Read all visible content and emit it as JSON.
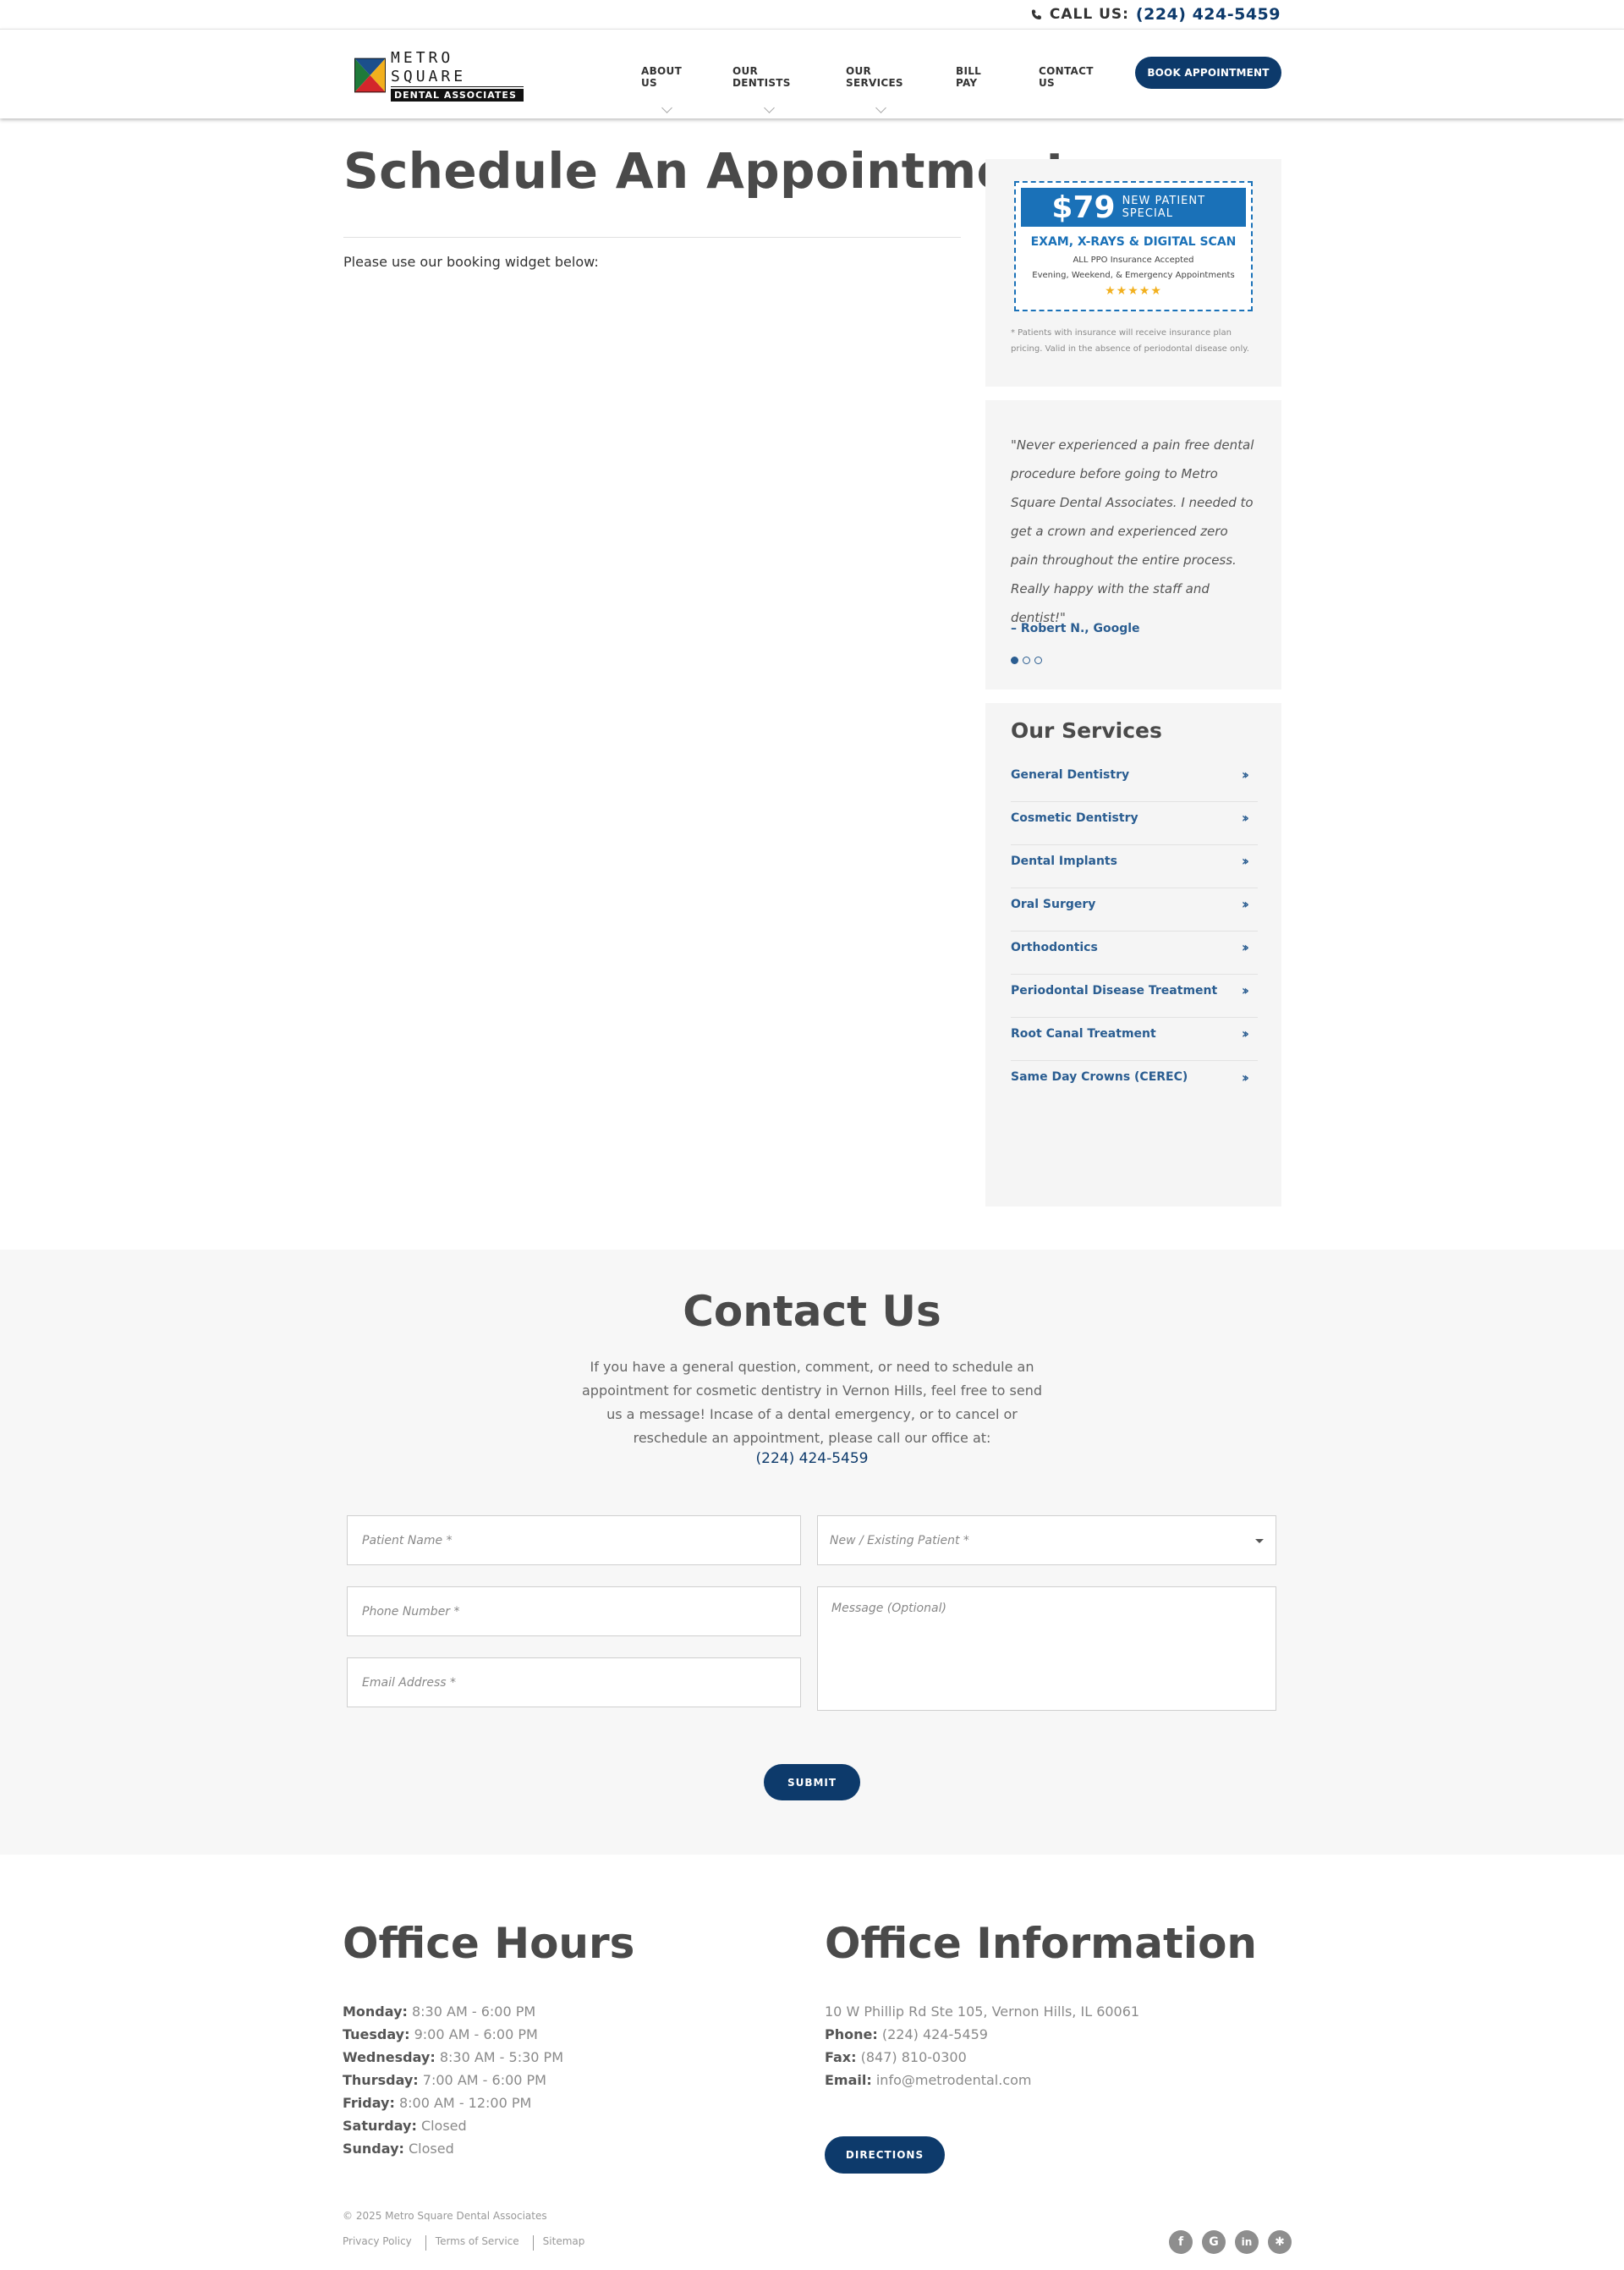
{
  "topbar": {
    "call_label": "CALL US:",
    "phone": "(224) 424-5459"
  },
  "logo": {
    "line1": "METRO SQUARE",
    "line2": "DENTAL ASSOCIATES"
  },
  "nav": {
    "items": [
      {
        "label": "About Us"
      },
      {
        "label": "Our Dentists"
      },
      {
        "label": "Our Services"
      },
      {
        "label": "Bill Pay"
      },
      {
        "label": "Contact Us"
      }
    ],
    "book_label": "Book Appointment"
  },
  "main": {
    "title": "Schedule An Appointment",
    "intro": "Please use our booking widget below:"
  },
  "promo": {
    "price": "$79",
    "special": "NEW PATIENT SPECIAL",
    "line1": "EXAM, X-RAYS & DIGITAL SCAN",
    "line2": "ALL PPO Insurance Accepted",
    "line3": "Evening, Weekend, & Emergency Appointments",
    "stars": "★★★★★",
    "rating": 5,
    "note": "* Patients with insurance will receive insurance plan pricing. Valid in the absence of periodontal disease only."
  },
  "review": {
    "quote": "\"Never experienced a pain free dental procedure before going to Metro Square Dental Associates. I needed to get a crown and experienced zero pain throughout the entire process. Really happy with the staff and dentist!\"",
    "author": "– Robert N., Google",
    "slides": 3,
    "active_slide": 1
  },
  "services": {
    "title": "Our Services",
    "items": [
      {
        "label": "General Dentistry"
      },
      {
        "label": "Cosmetic Dentistry"
      },
      {
        "label": "Dental Implants"
      },
      {
        "label": "Oral Surgery"
      },
      {
        "label": "Orthodontics"
      },
      {
        "label": "Periodontal Disease Treatment"
      },
      {
        "label": "Root Canal Treatment"
      },
      {
        "label": "Same Day Crowns (CEREC)"
      }
    ]
  },
  "contact": {
    "title": "Contact Us",
    "text": "If you have a general question, comment, or need to schedule an appointment for cosmetic dentistry in Vernon Hills, feel free to send us a message! Incase of a dental emergency, or to cancel or reschedule an appointment, please call our office at:",
    "phone": "(224) 424-5459",
    "form": {
      "name_placeholder": "Patient Name *",
      "phone_placeholder": "Phone Number *",
      "email_placeholder": "Email Address *",
      "patient_type_placeholder": "New / Existing Patient *",
      "message_placeholder": "Message (Optional)",
      "submit_label": "Submit"
    }
  },
  "footer": {
    "hours_title": "Office Hours",
    "hours": [
      {
        "day": "Monday:",
        "time": "8:30 AM - 6:00 PM"
      },
      {
        "day": "Tuesday:",
        "time": "9:00 AM - 6:00 PM"
      },
      {
        "day": "Wednesday:",
        "time": "8:30 AM - 5:30 PM"
      },
      {
        "day": "Thursday:",
        "time": "7:00 AM - 6:00 PM"
      },
      {
        "day": "Friday:",
        "time": "8:00 AM - 12:00 PM"
      },
      {
        "day": "Saturday:",
        "time": "Closed"
      },
      {
        "day": "Sunday:",
        "time": "Closed"
      }
    ],
    "info_title": "Office Information",
    "address": "10 W Phillip Rd Ste 105, Vernon Hills, IL 60061",
    "phone_label": "Phone:",
    "phone": "(224) 424-5459",
    "fax_label": "Fax:",
    "fax": "(847) 810-0300",
    "email_label": "Email:",
    "email": "info@metrodental.com",
    "directions_label": "Directions",
    "copyright": "© 2025 Metro Square Dental Associates",
    "legal": [
      {
        "label": "Privacy Policy"
      },
      {
        "label": "Terms of Service"
      },
      {
        "label": "Sitemap"
      }
    ],
    "socials": [
      {
        "icon": "facebook-icon",
        "glyph": "f"
      },
      {
        "icon": "google-icon",
        "glyph": "G"
      },
      {
        "icon": "linkedin-icon",
        "glyph": "in"
      },
      {
        "icon": "yelp-icon",
        "glyph": "✱"
      }
    ]
  },
  "colors": {
    "brand": "#0d3a6b",
    "link": "#2a5d91",
    "promo": "#1a71b8",
    "star": "#f2b01e"
  }
}
